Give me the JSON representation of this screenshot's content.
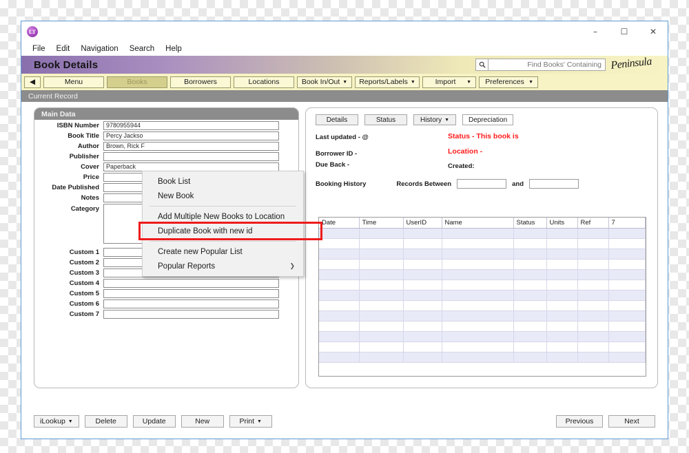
{
  "window": {
    "app_icon_label": "LT",
    "controls": {
      "minimize": "–",
      "maximize": "☐",
      "close": "✕"
    }
  },
  "menubar": {
    "items": [
      "File",
      "Edit",
      "Navigation",
      "Search",
      "Help"
    ]
  },
  "header": {
    "page_title": "Book Details",
    "brand": "Peninsula",
    "search_icon": "search-icon",
    "search_placeholder": "Find Books' Containing",
    "search_value": ""
  },
  "toolbar": {
    "back_icon": "◀",
    "buttons": [
      {
        "label": "Menu",
        "caret": false,
        "active": false
      },
      {
        "label": "Books",
        "caret": false,
        "active": true
      },
      {
        "label": "Borrowers",
        "caret": false,
        "active": false
      },
      {
        "label": "Locations",
        "caret": false,
        "active": false
      },
      {
        "label": "Book In/Out",
        "caret": true,
        "active": false
      },
      {
        "label": "Reports/Labels",
        "caret": true,
        "active": false
      },
      {
        "label": "Import",
        "caret": true,
        "active": false
      },
      {
        "label": "Preferences",
        "caret": true,
        "active": false
      }
    ]
  },
  "current_record_band": "Current Record",
  "dropdown": {
    "open_for": "Books",
    "items": [
      {
        "label": "Book List",
        "separator_after": false,
        "submenu": false,
        "highlighted": false
      },
      {
        "label": "New Book",
        "separator_after": true,
        "submenu": false,
        "highlighted": false
      },
      {
        "label": "Add Multiple New Books to Location",
        "separator_after": false,
        "submenu": false,
        "highlighted": false
      },
      {
        "label": "Duplicate Book with new id",
        "separator_after": true,
        "submenu": false,
        "highlighted": true
      },
      {
        "label": "Create new Popular List",
        "separator_after": false,
        "submenu": false,
        "highlighted": false
      },
      {
        "label": "Popular Reports",
        "separator_after": false,
        "submenu": true,
        "highlighted": false
      }
    ],
    "highlight_color": "#ee1b1b"
  },
  "left_panel": {
    "section_title": "Main Data",
    "fields": [
      {
        "label": "ISBN Number",
        "value": "9780955944",
        "type": "text"
      },
      {
        "label": "Book Title",
        "value": "Percy Jackso",
        "type": "text"
      },
      {
        "label": "Author",
        "value": "Brown, Rick F",
        "type": "text"
      },
      {
        "label": "Publisher",
        "value": "",
        "type": "text"
      },
      {
        "label": "Cover",
        "value": "Paperback",
        "type": "text"
      },
      {
        "label": "Price",
        "value": "",
        "type": "text"
      },
      {
        "label": "Date Published",
        "value": "",
        "type": "text"
      },
      {
        "label": "Notes",
        "value": "",
        "type": "text"
      },
      {
        "label": "Category",
        "value": "",
        "type": "textarea"
      },
      {
        "label": "Custom 1",
        "value": "",
        "type": "text"
      },
      {
        "label": "Custom 2",
        "value": "",
        "type": "text"
      },
      {
        "label": "Custom 3",
        "value": "",
        "type": "text"
      },
      {
        "label": "Custom 4",
        "value": "",
        "type": "text"
      },
      {
        "label": "Custom 5",
        "value": "",
        "type": "text"
      },
      {
        "label": "Custom 6",
        "value": "",
        "type": "text"
      },
      {
        "label": "Custom 7",
        "value": "",
        "type": "text"
      }
    ]
  },
  "right_panel": {
    "tabs": [
      {
        "label": "Details",
        "caret": false
      },
      {
        "label": "Status",
        "caret": false
      },
      {
        "label": "History",
        "caret": true
      },
      {
        "label": "Depreciation",
        "caret": false
      }
    ],
    "status_lines": {
      "last_updated": "Last updated -  @",
      "borrower_id": "Borrower ID -",
      "due_back": "Due Back -",
      "status": "Status - This book is",
      "location": "Location -",
      "created": "Created:"
    },
    "status_color": "#ff1a1a",
    "booking": {
      "title": "Booking History",
      "records_between_label": "Records Between",
      "and_label": "and",
      "from_value": "",
      "to_value": ""
    },
    "table": {
      "columns": [
        "Date",
        "Time",
        "UserID",
        "Name",
        "Status",
        "Units",
        "Ref",
        "7"
      ],
      "rows": [],
      "empty_row_count": 13
    }
  },
  "bottom_bar": {
    "left_buttons": [
      {
        "label": "iLookup",
        "caret": true
      },
      {
        "label": "Delete",
        "caret": false
      },
      {
        "label": "Update",
        "caret": false
      },
      {
        "label": "New",
        "caret": false
      },
      {
        "label": "Print",
        "caret": true
      }
    ],
    "right_buttons": [
      {
        "label": "Previous",
        "caret": false
      },
      {
        "label": "Next",
        "caret": false
      }
    ]
  }
}
